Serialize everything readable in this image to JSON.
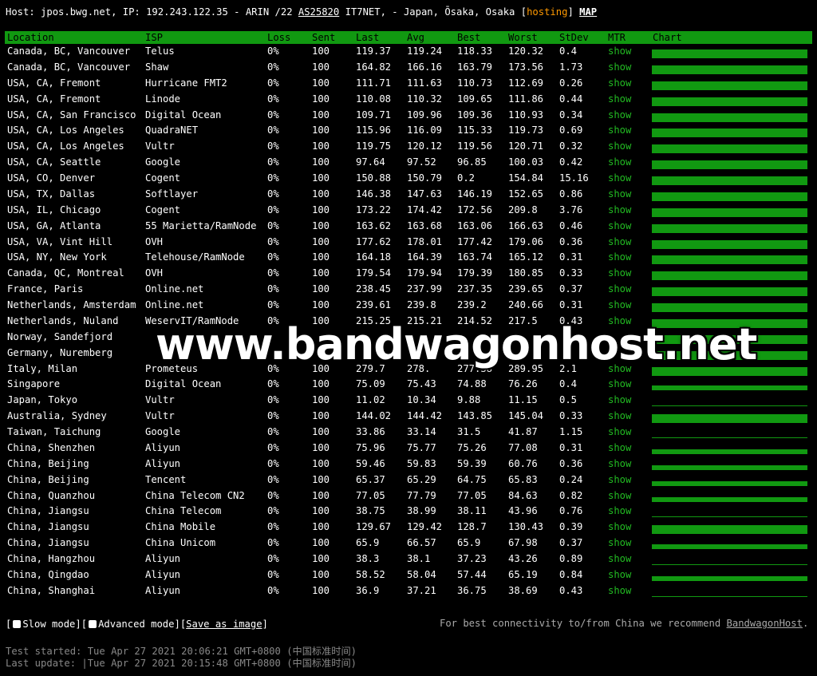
{
  "header": {
    "host_text": "Host: jpos.bwg.net, IP: 192.243.122.35 - ARIN /22 ",
    "as_link": "AS25820",
    "after_as": " IT7NET, - Japan, Ōsaka, Osaka [",
    "hosting": "hosting",
    "after_hosting": "] ",
    "map_link": "MAP"
  },
  "columns": [
    "Location",
    "ISP",
    "Loss",
    "Sent",
    "Last",
    "Avg",
    "Best",
    "Worst",
    "StDev",
    "MTR",
    "Chart"
  ],
  "rows": [
    {
      "loc": "Canada, BC, Vancouver",
      "isp": "Telus",
      "loss": "0%",
      "sent": "100",
      "last": "119.37",
      "avg": "119.24",
      "best": "118.33",
      "worst": "120.32",
      "stdev": "0.4",
      "mtr": "show",
      "chart": "full"
    },
    {
      "loc": "Canada, BC, Vancouver",
      "isp": "Shaw",
      "loss": "0%",
      "sent": "100",
      "last": "164.82",
      "avg": "166.16",
      "best": "163.79",
      "worst": "173.56",
      "stdev": "1.73",
      "mtr": "show",
      "chart": "full"
    },
    {
      "loc": "USA, CA, Fremont",
      "isp": "Hurricane FMT2",
      "loss": "0%",
      "sent": "100",
      "last": "111.71",
      "avg": "111.63",
      "best": "110.73",
      "worst": "112.69",
      "stdev": "0.26",
      "mtr": "show",
      "chart": "full"
    },
    {
      "loc": "USA, CA, Fremont",
      "isp": "Linode",
      "loss": "0%",
      "sent": "100",
      "last": "110.08",
      "avg": "110.32",
      "best": "109.65",
      "worst": "111.86",
      "stdev": "0.44",
      "mtr": "show",
      "chart": "full"
    },
    {
      "loc": "USA, CA, San Francisco",
      "isp": "Digital Ocean",
      "loss": "0%",
      "sent": "100",
      "last": "109.71",
      "avg": "109.96",
      "best": "109.36",
      "worst": "110.93",
      "stdev": "0.34",
      "mtr": "show",
      "chart": "full"
    },
    {
      "loc": "USA, CA, Los Angeles",
      "isp": "QuadraNET",
      "loss": "0%",
      "sent": "100",
      "last": "115.96",
      "avg": "116.09",
      "best": "115.33",
      "worst": "119.73",
      "stdev": "0.69",
      "mtr": "show",
      "chart": "full"
    },
    {
      "loc": "USA, CA, Los Angeles",
      "isp": "Vultr",
      "loss": "0%",
      "sent": "100",
      "last": "119.75",
      "avg": "120.12",
      "best": "119.56",
      "worst": "120.71",
      "stdev": "0.32",
      "mtr": "show",
      "chart": "full"
    },
    {
      "loc": "USA, CA, Seattle",
      "isp": "Google",
      "loss": "0%",
      "sent": "100",
      "last": "97.64",
      "avg": "97.52",
      "best": "96.85",
      "worst": "100.03",
      "stdev": "0.42",
      "mtr": "show",
      "chart": "full"
    },
    {
      "loc": "USA, CO, Denver",
      "isp": "Cogent",
      "loss": "0%",
      "sent": "100",
      "last": "150.88",
      "avg": "150.79",
      "best": "0.2",
      "worst": "154.84",
      "stdev": "15.16",
      "mtr": "show",
      "chart": "full"
    },
    {
      "loc": "USA, TX, Dallas",
      "isp": "Softlayer",
      "loss": "0%",
      "sent": "100",
      "last": "146.38",
      "avg": "147.63",
      "best": "146.19",
      "worst": "152.65",
      "stdev": "0.86",
      "mtr": "show",
      "chart": "full"
    },
    {
      "loc": "USA, IL, Chicago",
      "isp": "Cogent",
      "loss": "0%",
      "sent": "100",
      "last": "173.22",
      "avg": "174.42",
      "best": "172.56",
      "worst": "209.8",
      "stdev": "3.76",
      "mtr": "show",
      "chart": "full"
    },
    {
      "loc": "USA, GA, Atlanta",
      "isp": "55 Marietta/RamNode",
      "loss": "0%",
      "sent": "100",
      "last": "163.62",
      "avg": "163.68",
      "best": "163.06",
      "worst": "166.63",
      "stdev": "0.46",
      "mtr": "show",
      "chart": "full"
    },
    {
      "loc": "USA, VA, Vint Hill",
      "isp": "OVH",
      "loss": "0%",
      "sent": "100",
      "last": "177.62",
      "avg": "178.01",
      "best": "177.42",
      "worst": "179.06",
      "stdev": "0.36",
      "mtr": "show",
      "chart": "full"
    },
    {
      "loc": "USA, NY, New York",
      "isp": "Telehouse/RamNode",
      "loss": "0%",
      "sent": "100",
      "last": "164.18",
      "avg": "164.39",
      "best": "163.74",
      "worst": "165.12",
      "stdev": "0.31",
      "mtr": "show",
      "chart": "full"
    },
    {
      "loc": "Canada, QC, Montreal",
      "isp": "OVH",
      "loss": "0%",
      "sent": "100",
      "last": "179.54",
      "avg": "179.94",
      "best": "179.39",
      "worst": "180.85",
      "stdev": "0.33",
      "mtr": "show",
      "chart": "full"
    },
    {
      "loc": "France, Paris",
      "isp": "Online.net",
      "loss": "0%",
      "sent": "100",
      "last": "238.45",
      "avg": "237.99",
      "best": "237.35",
      "worst": "239.65",
      "stdev": "0.37",
      "mtr": "show",
      "chart": "full"
    },
    {
      "loc": "Netherlands, Amsterdam",
      "isp": "Online.net",
      "loss": "0%",
      "sent": "100",
      "last": "239.61",
      "avg": "239.8",
      "best": "239.2",
      "worst": "240.66",
      "stdev": "0.31",
      "mtr": "show",
      "chart": "full"
    },
    {
      "loc": "Netherlands, Nuland",
      "isp": "WeservIT/RamNode",
      "loss": "0%",
      "sent": "100",
      "last": "215.25",
      "avg": "215.21",
      "best": "214.52",
      "worst": "217.5",
      "stdev": "0.43",
      "mtr": "show",
      "chart": "full"
    },
    {
      "loc": "Norway, Sandefjord",
      "isp": "",
      "loss": "",
      "sent": "",
      "last": "",
      "avg": "",
      "best": "",
      "worst": "",
      "stdev": "",
      "mtr": "",
      "chart": "full"
    },
    {
      "loc": "Germany, Nuremberg",
      "isp": "",
      "loss": "",
      "sent": "",
      "last": "",
      "avg": "",
      "best": "",
      "worst": "",
      "stdev": "",
      "mtr": "",
      "chart": "full"
    },
    {
      "loc": "Italy, Milan",
      "isp": "Prometeus",
      "loss": "0%",
      "sent": "100",
      "last": "279.7",
      "avg": "278.",
      "best": "277.38",
      "worst": "289.95",
      "stdev": "2.1",
      "mtr": "show",
      "chart": "full"
    },
    {
      "loc": "Singapore",
      "isp": "Digital Ocean",
      "loss": "0%",
      "sent": "100",
      "last": "75.09",
      "avg": "75.43",
      "best": "74.88",
      "worst": "76.26",
      "stdev": "0.4",
      "mtr": "show",
      "chart": "mid"
    },
    {
      "loc": "Japan, Tokyo",
      "isp": "Vultr",
      "loss": "0%",
      "sent": "100",
      "last": "11.02",
      "avg": "10.34",
      "best": "9.88",
      "worst": "11.15",
      "stdev": "0.5",
      "mtr": "show",
      "chart": "thin"
    },
    {
      "loc": "Australia, Sydney",
      "isp": "Vultr",
      "loss": "0%",
      "sent": "100",
      "last": "144.02",
      "avg": "144.42",
      "best": "143.85",
      "worst": "145.04",
      "stdev": "0.33",
      "mtr": "show",
      "chart": "full"
    },
    {
      "loc": "Taiwan, Taichung",
      "isp": "Google",
      "loss": "0%",
      "sent": "100",
      "last": "33.86",
      "avg": "33.14",
      "best": "31.5",
      "worst": "41.87",
      "stdev": "1.15",
      "mtr": "show",
      "chart": "thin"
    },
    {
      "loc": "China, Shenzhen",
      "isp": "Aliyun",
      "loss": "0%",
      "sent": "100",
      "last": "75.96",
      "avg": "75.77",
      "best": "75.26",
      "worst": "77.08",
      "stdev": "0.31",
      "mtr": "show",
      "chart": "mid"
    },
    {
      "loc": "China, Beijing",
      "isp": "Aliyun",
      "loss": "0%",
      "sent": "100",
      "last": "59.46",
      "avg": "59.83",
      "best": "59.39",
      "worst": "60.76",
      "stdev": "0.36",
      "mtr": "show",
      "chart": "mid"
    },
    {
      "loc": "China, Beijing",
      "isp": "Tencent",
      "loss": "0%",
      "sent": "100",
      "last": "65.37",
      "avg": "65.29",
      "best": "64.75",
      "worst": "65.83",
      "stdev": "0.24",
      "mtr": "show",
      "chart": "mid"
    },
    {
      "loc": "China, Quanzhou",
      "isp": "China Telecom CN2",
      "loss": "0%",
      "sent": "100",
      "last": "77.05",
      "avg": "77.79",
      "best": "77.05",
      "worst": "84.63",
      "stdev": "0.82",
      "mtr": "show",
      "chart": "mid"
    },
    {
      "loc": "China, Jiangsu",
      "isp": "China Telecom",
      "loss": "0%",
      "sent": "100",
      "last": "38.75",
      "avg": "38.99",
      "best": "38.11",
      "worst": "43.96",
      "stdev": "0.76",
      "mtr": "show",
      "chart": "thin"
    },
    {
      "loc": "China, Jiangsu",
      "isp": "China Mobile",
      "loss": "0%",
      "sent": "100",
      "last": "129.67",
      "avg": "129.42",
      "best": "128.7",
      "worst": "130.43",
      "stdev": "0.39",
      "mtr": "show",
      "chart": "full"
    },
    {
      "loc": "China, Jiangsu",
      "isp": "China Unicom",
      "loss": "0%",
      "sent": "100",
      "last": "65.9",
      "avg": "66.57",
      "best": "65.9",
      "worst": "67.98",
      "stdev": "0.37",
      "mtr": "show",
      "chart": "mid"
    },
    {
      "loc": "China, Hangzhou",
      "isp": "Aliyun",
      "loss": "0%",
      "sent": "100",
      "last": "38.3",
      "avg": "38.1",
      "best": "37.23",
      "worst": "43.26",
      "stdev": "0.89",
      "mtr": "show",
      "chart": "thin"
    },
    {
      "loc": "China, Qingdao",
      "isp": "Aliyun",
      "loss": "0%",
      "sent": "100",
      "last": "58.52",
      "avg": "58.04",
      "best": "57.44",
      "worst": "65.19",
      "stdev": "0.84",
      "mtr": "show",
      "chart": "mid"
    },
    {
      "loc": "China, Shanghai",
      "isp": "Aliyun",
      "loss": "0%",
      "sent": "100",
      "last": "36.9",
      "avg": "37.21",
      "best": "36.75",
      "worst": "38.69",
      "stdev": "0.43",
      "mtr": "show",
      "chart": "thin"
    }
  ],
  "watermark": "www.bandwagonhost.net",
  "options": {
    "slow_mode": "Slow mode",
    "advanced_mode": "Advanced mode",
    "save_image": "Save as image"
  },
  "recommend": {
    "text": "For best connectivity to/from China we recommend ",
    "link": "BandwagonHost",
    "end": "."
  },
  "footer": {
    "started": "Test started: Tue Apr 27 2021 20:06:21 GMT+0800 (中国标准时间)",
    "updated": "Last update: |Tue Apr 27 2021 20:15:48 GMT+0800 (中国标准时间)"
  },
  "colors": {
    "header_bar": "#119911",
    "mtr_link": "#22bb22",
    "hosting": "#ff9900"
  }
}
